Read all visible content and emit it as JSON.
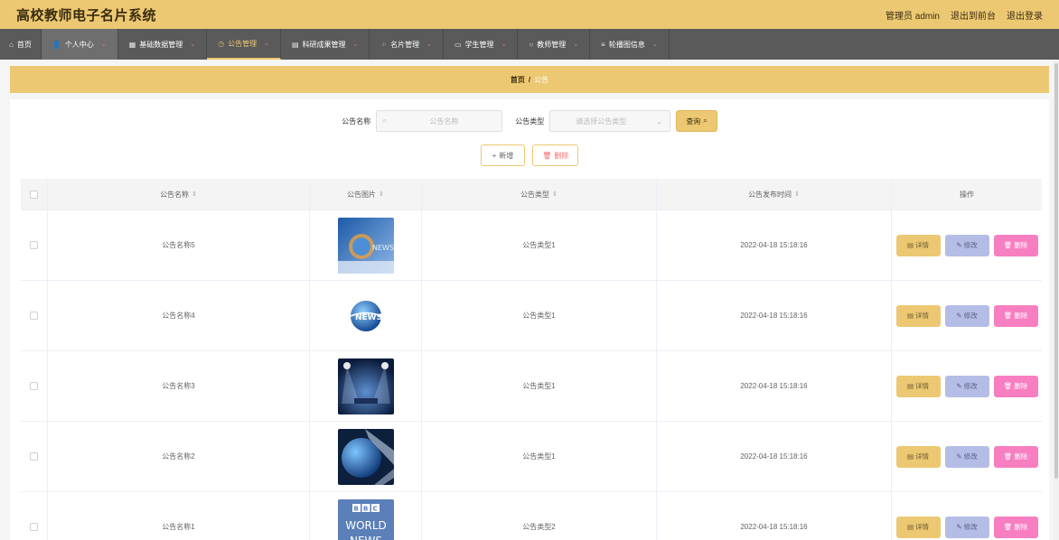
{
  "header": {
    "app_title": "高校教师电子名片系统",
    "admin_label": "管理员 admin",
    "to_front": "退出到前台",
    "logout": "退出登录"
  },
  "nav": {
    "home": "首页",
    "items": [
      {
        "label": "个人中心",
        "icon": "user-icon"
      },
      {
        "label": "基础数据管理",
        "icon": "grid-icon"
      },
      {
        "label": "公告管理",
        "icon": "clock-icon"
      },
      {
        "label": "科研成果管理",
        "icon": "list-icon"
      },
      {
        "label": "名片管理",
        "icon": "apps-icon"
      },
      {
        "label": "学生管理",
        "icon": "card-icon"
      },
      {
        "label": "教师管理",
        "icon": "circle-icon"
      },
      {
        "label": "轮播图信息",
        "icon": "menu-icon"
      }
    ]
  },
  "breadcrumb": {
    "home": "首页",
    "separator": "/",
    "current": "公告"
  },
  "search": {
    "name_label": "公告名称",
    "name_placeholder": "公告名称",
    "type_label": "公告类型",
    "type_placeholder": "请选择公告类型",
    "query_button": "查询"
  },
  "toolbar": {
    "add_label": "新增",
    "delete_label": "删除"
  },
  "table": {
    "columns": [
      "公告名称",
      "公告图片",
      "公告类型",
      "公告发布时间",
      "操作"
    ],
    "rows": [
      {
        "name": "公告名称5",
        "type": "公告类型1",
        "time": "2022-04-18 15:18:16",
        "image": "news-image-1"
      },
      {
        "name": "公告名称4",
        "type": "公告类型1",
        "time": "2022-04-18 15:18:16",
        "image": "news-globe-image"
      },
      {
        "name": "公告名称3",
        "type": "公告类型1",
        "time": "2022-04-18 15:18:16",
        "image": "news-studio-image"
      },
      {
        "name": "公告名称2",
        "type": "公告类型1",
        "time": "2022-04-18 15:18:16",
        "image": "news-globe-dark-image"
      },
      {
        "name": "公告名称1",
        "type": "公告类型2",
        "time": "2022-04-18 15:18:16",
        "image": "bbc-world-news-image"
      }
    ],
    "row_actions": {
      "detail": "详情",
      "edit": "修改",
      "delete": "删除"
    },
    "bbc_logo_text": "BBC WORLD NEWS"
  },
  "colors": {
    "accent": "#ecc872",
    "nav_bg": "#5a5a5a",
    "edit_btn": "#b4bde6",
    "delete_btn": "#f77fc1"
  }
}
